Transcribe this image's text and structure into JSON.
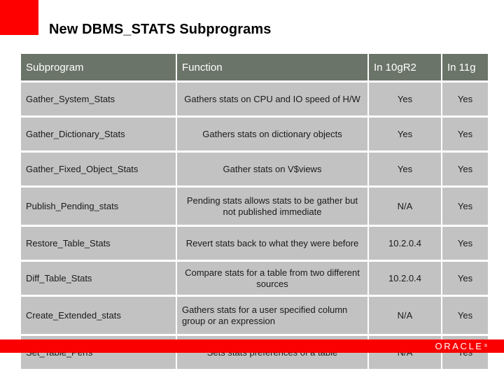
{
  "slide": {
    "title": "New DBMS_STATS Subprograms",
    "accent_color": "#fe0000",
    "header_color": "#6b7468",
    "cell_color": "#c2c2c2"
  },
  "table": {
    "columns": [
      "Subprogram",
      "Function",
      "In 10gR2",
      "In 11g"
    ],
    "rows": [
      {
        "subprogram": "Gather_System_Stats",
        "function": "Gathers stats on CPU and IO speed of H/W",
        "in_10gr2": "Yes",
        "in_11g": "Yes"
      },
      {
        "subprogram": "Gather_Dictionary_Stats",
        "function": "Gathers stats on dictionary objects",
        "in_10gr2": "Yes",
        "in_11g": "Yes"
      },
      {
        "subprogram": "Gather_Fixed_Object_Stats",
        "function": "Gather stats on V$views",
        "in_10gr2": "Yes",
        "in_11g": "Yes"
      },
      {
        "subprogram": "Publish_Pending_stats",
        "function": "Pending stats allows stats to be gather but not published immediate",
        "in_10gr2": "N/A",
        "in_11g": "Yes"
      },
      {
        "subprogram": "Restore_Table_Stats",
        "function": "Revert stats back to what they were before",
        "in_10gr2": "10.2.0.4",
        "in_11g": "Yes"
      },
      {
        "subprogram": "Diff_Table_Stats",
        "function": "Compare stats for a table from two different sources",
        "in_10gr2": "10.2.0.4",
        "in_11g": "Yes"
      },
      {
        "subprogram": "Create_Extended_stats",
        "function": "Gathers stats for a user specified column group or an expression",
        "in_10gr2": "N/A",
        "in_11g": "Yes"
      },
      {
        "subprogram": "Set_Table_Perfs",
        "function": "Sets stats preferences of a table",
        "in_10gr2": "N/A",
        "in_11g": "Yes"
      }
    ]
  },
  "footer": {
    "brand": "ORACLE",
    "trademark": "®",
    "bar_color": "#fa0000"
  }
}
